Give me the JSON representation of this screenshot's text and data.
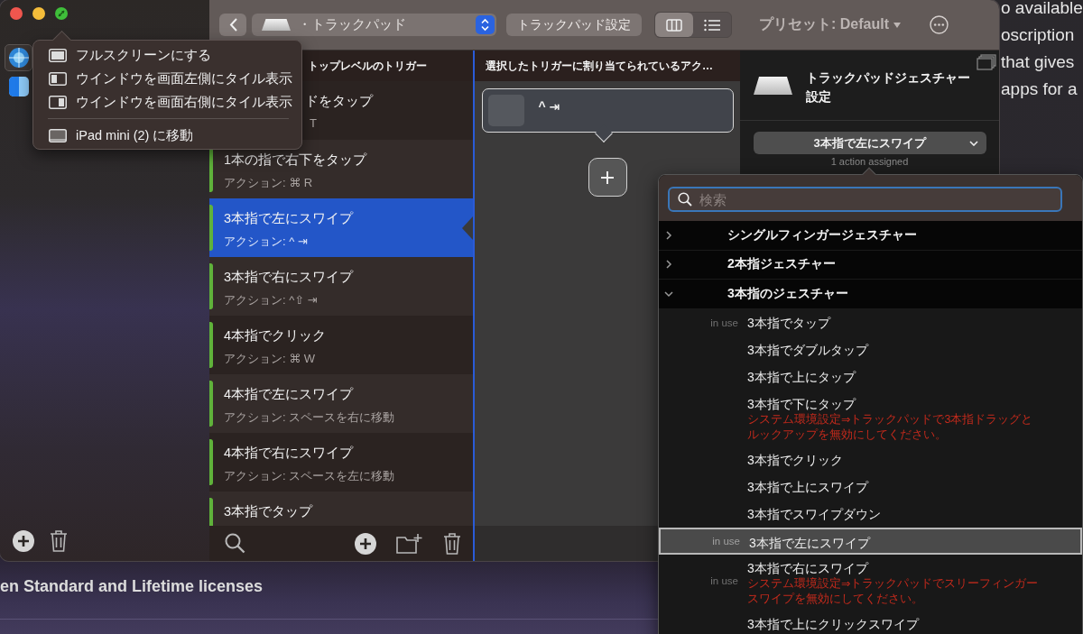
{
  "background_page": {
    "side_lines": [
      "o available",
      "oscription",
      "that gives",
      "apps for a"
    ],
    "footer_text": "en Standard and Lifetime licenses"
  },
  "window": {
    "sidebar": {
      "items": [
        {
          "kind": "globe",
          "selected": true
        },
        {
          "kind": "app",
          "selected": false
        }
      ]
    },
    "toolbar": {
      "device_popup": "・トラックパッド",
      "settings_button": "トラックパッド設定",
      "view_modes": [
        {
          "kind": "columns",
          "selected": true
        },
        {
          "kind": "list",
          "selected": false
        }
      ],
      "preset": "プリセット: Default"
    },
    "triggers": {
      "header": "トップレベルのトリガー",
      "items": [
        {
          "title": "ドをタップ",
          "action": "T",
          "selected": false
        },
        {
          "title": "1本の指で右下をタップ",
          "action": "アクション: ⌘ R",
          "enabled": true,
          "selected": false
        },
        {
          "title": "3本指で左にスワイプ",
          "action": "アクション: ^ ⇥",
          "enabled": true,
          "selected": true
        },
        {
          "title": "3本指で右にスワイプ",
          "action": "アクション: ^⇧ ⇥",
          "enabled": true,
          "selected": false
        },
        {
          "title": "4本指でクリック",
          "action": "アクション: ⌘ W",
          "enabled": true,
          "selected": false
        },
        {
          "title": "4本指で左にスワイプ",
          "action": "アクション: スペースを右に移動",
          "enabled": true,
          "selected": false
        },
        {
          "title": "4本指で右にスワイプ",
          "action": "アクション: スペースを左に移動",
          "enabled": true,
          "selected": false
        },
        {
          "title": "3本指でタップ",
          "enabled": true,
          "selected": false
        }
      ]
    },
    "actions": {
      "header": "選択したトリガーに割り当てられているアク…",
      "items": [
        {
          "shortcut": "^ ⇥"
        }
      ]
    },
    "detail": {
      "title": "トラックパッドジェスチャー設定",
      "trigger_popup": "3本指で左にスワイプ",
      "assigned": "1 action assigned"
    }
  },
  "window_menu": {
    "groups": [
      [
        {
          "kind": "fullscreen",
          "label": "フルスクリーンにする"
        },
        {
          "kind": "tile-left",
          "label": "ウインドウを画面左側にタイル表示"
        },
        {
          "kind": "tile-right",
          "label": "ウインドウを画面右側にタイル表示"
        }
      ],
      [
        {
          "kind": "display",
          "label": "iPad mini (2) に移動"
        }
      ]
    ]
  },
  "gesture_picker": {
    "search_placeholder": "検索",
    "groups": [
      {
        "label": "シングルフィンガージェスチャー",
        "expanded": false
      },
      {
        "label": "2本指ジェスチャー",
        "expanded": false
      },
      {
        "label": "3本指のジェスチャー",
        "expanded": true,
        "children": [
          {
            "label": "3本指でタップ",
            "badge": "in use",
            "selected": false
          },
          {
            "label": "3本指でダブルタップ",
            "selected": false
          },
          {
            "label": "3本指で上にタップ",
            "selected": false
          },
          {
            "label": "3本指で下にタップ",
            "warning": "システム環境設定⇒トラックパッドで3本指ドラッグとルックアップを無効にしてください。",
            "selected": false
          },
          {
            "label": "3本指でクリック",
            "selected": false
          },
          {
            "label": "3本指で上にスワイプ",
            "selected": false
          },
          {
            "label": "3本指でスワイプダウン",
            "selected": false
          },
          {
            "label": "3本指で左にスワイプ",
            "badge": "in use",
            "selected": true
          },
          {
            "label": "3本指で右にスワイプ",
            "badge": "in use",
            "warning": "システム環境設定⇒トラックパッドでスリーフィンガースワイプを無効にしてください。",
            "selected": false
          },
          {
            "label": "3本指で上にクリックスワイプ",
            "selected": false
          }
        ]
      }
    ]
  }
}
